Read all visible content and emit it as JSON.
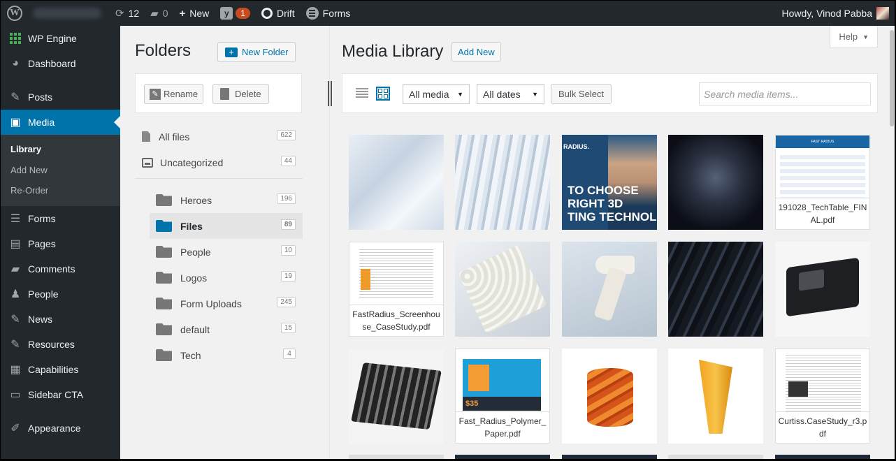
{
  "adminbar": {
    "updates_count": "12",
    "comments_count": "0",
    "new_label": "New",
    "yoast_badge": "1",
    "drift_label": "Drift",
    "forms_label": "Forms",
    "greeting": "Howdy, Vinod Pabba"
  },
  "sidebar": {
    "wp_engine": "WP Engine",
    "dashboard": "Dashboard",
    "posts": "Posts",
    "media": "Media",
    "media_sub": [
      "Library",
      "Add New",
      "Re-Order"
    ],
    "forms": "Forms",
    "pages": "Pages",
    "comments": "Comments",
    "people": "People",
    "news": "News",
    "resources": "Resources",
    "capabilities": "Capabilities",
    "sidebar_cta": "Sidebar CTA",
    "appearance": "Appearance"
  },
  "folders": {
    "title": "Folders",
    "new_folder": "New Folder",
    "rename": "Rename",
    "delete": "Delete",
    "all_files": {
      "label": "All files",
      "count": "622"
    },
    "uncategorized": {
      "label": "Uncategorized",
      "count": "44"
    },
    "items": [
      {
        "label": "Heroes",
        "count": "196"
      },
      {
        "label": "Files",
        "count": "89"
      },
      {
        "label": "People",
        "count": "10"
      },
      {
        "label": "Logos",
        "count": "19"
      },
      {
        "label": "Form Uploads",
        "count": "245"
      },
      {
        "label": "default",
        "count": "15"
      },
      {
        "label": "Tech",
        "count": "4"
      }
    ]
  },
  "media": {
    "title": "Media Library",
    "add_new": "Add New",
    "help": "Help",
    "filter_type": "All media",
    "filter_date": "All dates",
    "bulk_select": "Bulk Select",
    "search_placeholder": "Search media items...",
    "ad_brand": "RADIUS.",
    "ad_lines": [
      "TO CHOOSE",
      "RIGHT 3D",
      "TING TECHNOLO"
    ],
    "techtable_header": "FAST RADIUS",
    "paper_price": "$35",
    "captions": {
      "techtable": "191028_TechTable_FINAL.pdf",
      "screenhouse": "FastRadius_Screenhouse_CaseStudy.pdf",
      "polymer": "Fast_Radius_Polymer_Paper.pdf",
      "curtiss": "Curtiss.CaseStudy_r3.pdf"
    }
  }
}
